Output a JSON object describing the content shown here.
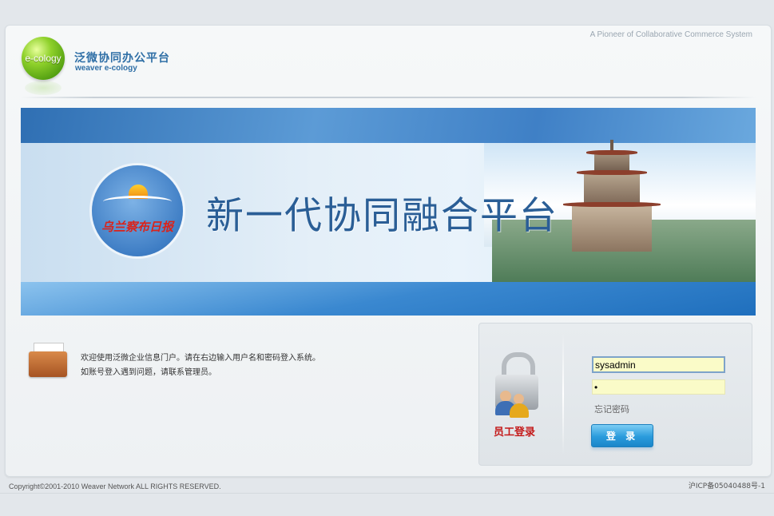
{
  "header": {
    "logo_text": "e-cology",
    "title": "泛微协同办公平台",
    "subtitle": "weaver e-cology",
    "tagline": "A Pioneer of Collaborative Commerce System"
  },
  "banner": {
    "emblem_text": "乌兰察布日报",
    "slogan": "新一代协同融合平台"
  },
  "welcome": {
    "line1": "欢迎使用泛微企业信息门户。请在右边输入用户名和密码登入系统。",
    "line2": "如账号登入遇到问题，请联系管理员。"
  },
  "login": {
    "label": "员工登录",
    "username_value": "sysadmin",
    "password_value": "•",
    "forgot_label": "忘记密码",
    "button_label": "登 录"
  },
  "footer": {
    "copyright": "Copyright©2001-2010 Weaver Network ALL RIGHTS RESERVED.",
    "icp": "沪ICP备05040488号-1"
  }
}
